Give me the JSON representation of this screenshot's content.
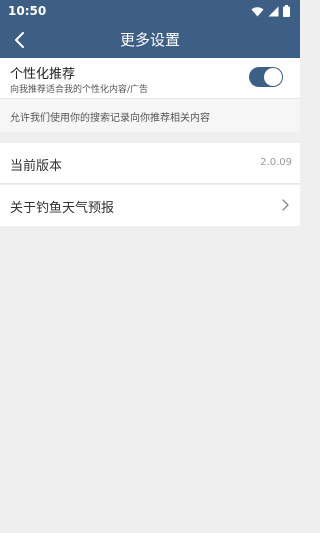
{
  "status_bar": {
    "time": "10:50",
    "icons": [
      "wifi-icon",
      "signal-icon",
      "battery-icon"
    ]
  },
  "app_bar": {
    "title": "更多设置",
    "back_icon": "back-arrow-icon"
  },
  "personalization": {
    "title": "个性化推荐",
    "subtitle": "向我推荐适合我的个性化内容/广告",
    "enabled": true
  },
  "notice": {
    "text": "允许我们使用你的搜索记录向你推荐相关内容"
  },
  "version": {
    "label": "当前版本",
    "value": "2.0.09"
  },
  "about": {
    "label": "关于钓鱼天气预报",
    "icon": "chevron-right-icon"
  },
  "colors": {
    "primary": "#3e5f85",
    "background": "#efefef"
  }
}
